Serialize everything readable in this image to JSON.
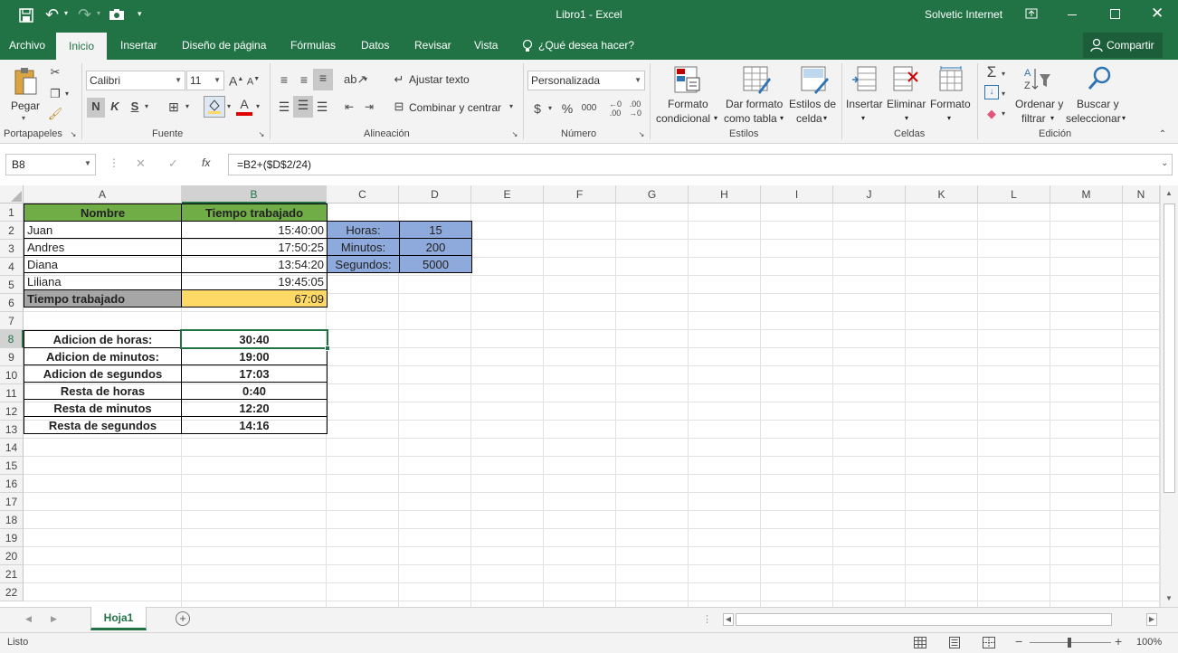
{
  "window": {
    "doc_title": "Libro1  -  Excel",
    "account": "Solvetic Internet"
  },
  "tabs": [
    "Archivo",
    "Inicio",
    "Insertar",
    "Diseño de página",
    "Fórmulas",
    "Datos",
    "Revisar",
    "Vista"
  ],
  "tell_me": "¿Qué desea hacer?",
  "share_label": "Compartir",
  "ribbon": {
    "clipboard": {
      "paste": "Pegar",
      "group": "Portapapeles"
    },
    "font": {
      "name": "Calibri",
      "size": "11",
      "bold": "N",
      "italic": "K",
      "underline": "S",
      "group": "Fuente"
    },
    "alignment": {
      "wrap": "Ajustar texto",
      "merge": "Combinar y centrar",
      "group": "Alineación"
    },
    "number": {
      "format": "Personalizada",
      "currency": "$",
      "percent": "%",
      "thousands": "000",
      "group": "Número"
    },
    "styles": {
      "conditional_1": "Formato",
      "conditional_2": "condicional",
      "table_1": "Dar formato",
      "table_2": "como tabla",
      "cell_1": "Estilos de",
      "cell_2": "celda",
      "group": "Estilos"
    },
    "cells": {
      "insert": "Insertar",
      "delete": "Eliminar",
      "format": "Formato",
      "group": "Celdas"
    },
    "editing": {
      "sort_1": "Ordenar y",
      "sort_2": "filtrar",
      "find_1": "Buscar y",
      "find_2": "seleccionar",
      "group": "Edición"
    }
  },
  "formula_bar": {
    "name_box": "B8",
    "fx": "fx",
    "formula": "=B2+($D$2/24)"
  },
  "columns": [
    "A",
    "B",
    "C",
    "D",
    "E",
    "F",
    "G",
    "H",
    "I",
    "J",
    "K",
    "L",
    "M",
    "N"
  ],
  "rows": [
    "1",
    "2",
    "3",
    "4",
    "5",
    "6",
    "7",
    "8",
    "9",
    "10",
    "11",
    "12",
    "13",
    "14",
    "15",
    "16",
    "17",
    "18",
    "19",
    "20",
    "21",
    "22"
  ],
  "cells": {
    "A1": "Nombre",
    "B1": "Tiempo trabajado",
    "A2": "Juan",
    "B2": "15:40:00",
    "A3": "Andres",
    "B3": "17:50:25",
    "A4": "Diana",
    "B4": "13:54:20",
    "A5": "Liliana",
    "B5": "19:45:05",
    "A6": "Tiempo trabajado",
    "B6": "67:09",
    "C2": "Horas:",
    "D2": "15",
    "C3": "Minutos:",
    "D3": "200",
    "C4": "Segundos:",
    "D4": "5000",
    "A8": "Adicion de horas:",
    "B8": "30:40",
    "A9": "Adicion de minutos:",
    "B9": "19:00",
    "A10": "Adicion de segundos",
    "B10": "17:03",
    "A11": "Resta de horas",
    "B11": "0:40",
    "A12": "Resta de minutos",
    "B12": "12:20",
    "A13": "Resta de segundos",
    "B13": "14:16"
  },
  "colors": {
    "excel_green": "#217346",
    "header_green": "#70ad47",
    "total_gray": "#a6a6a6",
    "total_yellow": "#ffd966",
    "param_blue": "#8ea9db"
  },
  "sheet_tab": "Hoja1",
  "status": {
    "ready": "Listo",
    "zoom": "100%"
  }
}
